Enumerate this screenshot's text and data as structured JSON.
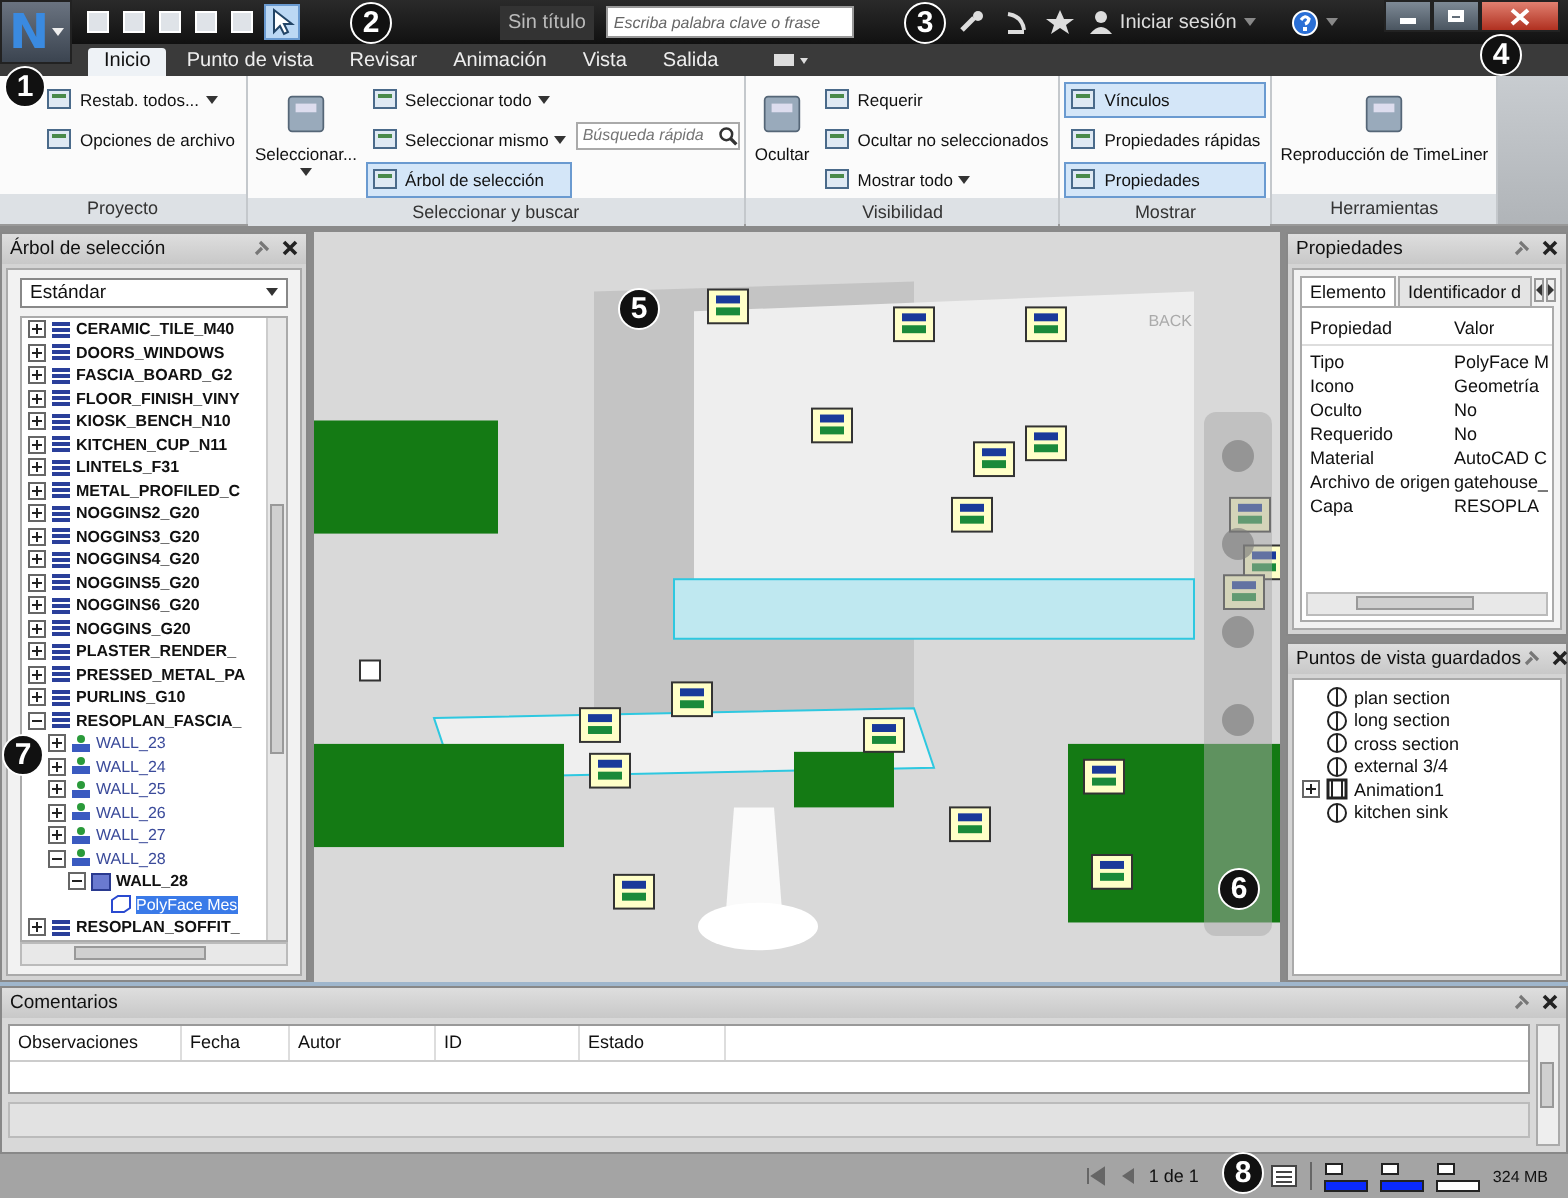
{
  "app_button": {
    "letter": "N"
  },
  "title": "Sin título",
  "search": {
    "placeholder": "Escriba palabra clave o frase"
  },
  "sign_in": "Iniciar sesión",
  "tabs": [
    {
      "label": "Inicio",
      "selected": true
    },
    {
      "label": "Punto de vista",
      "selected": false
    },
    {
      "label": "Revisar",
      "selected": false
    },
    {
      "label": "Animación",
      "selected": false
    },
    {
      "label": "Vista",
      "selected": false
    },
    {
      "label": "Salida",
      "selected": false
    }
  ],
  "ribbon": {
    "panels": [
      {
        "title": "Proyecto",
        "columns": [
          [
            {
              "kind": "small",
              "label": "Restab. todos...",
              "dropdown": true,
              "selected": false
            },
            {
              "kind": "small",
              "label": "Opciones de archivo",
              "dropdown": false,
              "selected": false
            }
          ]
        ]
      },
      {
        "title": "Seleccionar y buscar",
        "columns": [
          [
            {
              "kind": "large",
              "label": "Seleccionar...",
              "dropdown": true,
              "selected": false
            }
          ],
          [
            {
              "kind": "small",
              "label": "Seleccionar todo",
              "dropdown": true,
              "selected": false
            },
            {
              "kind": "small",
              "label": "Seleccionar mismo",
              "dropdown": true,
              "selected": false
            },
            {
              "kind": "small",
              "label": "Árbol de selección",
              "dropdown": false,
              "selected": true
            }
          ],
          [
            {
              "kind": "search",
              "placeholder": "Búsqueda rápida"
            }
          ]
        ]
      },
      {
        "title": "Visibilidad",
        "columns": [
          [
            {
              "kind": "large",
              "label": "Ocultar",
              "dropdown": false,
              "selected": false
            }
          ],
          [
            {
              "kind": "small",
              "label": "Requerir",
              "dropdown": false,
              "selected": false
            },
            {
              "kind": "small",
              "label": "Ocultar no seleccionados",
              "dropdown": false,
              "selected": false
            },
            {
              "kind": "small",
              "label": "Mostrar todo",
              "dropdown": true,
              "selected": false
            }
          ]
        ]
      },
      {
        "title": "Mostrar",
        "columns": [
          [
            {
              "kind": "small",
              "label": "Vínculos",
              "dropdown": false,
              "selected": true
            },
            {
              "kind": "small",
              "label": "Propiedades rápidas",
              "dropdown": false,
              "selected": false
            },
            {
              "kind": "small",
              "label": "Propiedades",
              "dropdown": false,
              "selected": true
            }
          ]
        ]
      },
      {
        "title": "Herramientas",
        "columns": [
          [
            {
              "kind": "large",
              "label": "Reproducción de TimeLiner",
              "dropdown": false,
              "selected": false
            }
          ]
        ]
      }
    ]
  },
  "selection_tree": {
    "title": "Árbol de selección",
    "mode": "Estándar",
    "items": [
      {
        "label": "CERAMIC_TILE_M40",
        "kind": "layer",
        "expanded": false,
        "selected": false
      },
      {
        "label": "DOORS_WINDOWS",
        "kind": "layer",
        "expanded": false,
        "selected": false
      },
      {
        "label": "FASCIA_BOARD_G2",
        "kind": "layer",
        "expanded": false,
        "selected": false
      },
      {
        "label": "FLOOR_FINISH_VINY",
        "kind": "layer",
        "expanded": false,
        "selected": false
      },
      {
        "label": "KIOSK_BENCH_N10",
        "kind": "layer",
        "expanded": false,
        "selected": false
      },
      {
        "label": "KITCHEN_CUP_N11",
        "kind": "layer",
        "expanded": false,
        "selected": false
      },
      {
        "label": "LINTELS_F31",
        "kind": "layer",
        "expanded": false,
        "selected": false
      },
      {
        "label": "METAL_PROFILED_C",
        "kind": "layer",
        "expanded": false,
        "selected": false
      },
      {
        "label": "NOGGINS2_G20",
        "kind": "layer",
        "expanded": false,
        "selected": false
      },
      {
        "label": "NOGGINS3_G20",
        "kind": "layer",
        "expanded": false,
        "selected": false
      },
      {
        "label": "NOGGINS4_G20",
        "kind": "layer",
        "expanded": false,
        "selected": false
      },
      {
        "label": "NOGGINS5_G20",
        "kind": "layer",
        "expanded": false,
        "selected": false
      },
      {
        "label": "NOGGINS6_G20",
        "kind": "layer",
        "expanded": false,
        "selected": false
      },
      {
        "label": "NOGGINS_G20",
        "kind": "layer",
        "expanded": false,
        "selected": false
      },
      {
        "label": "PLASTER_RENDER_",
        "kind": "layer",
        "expanded": false,
        "selected": false
      },
      {
        "label": "PRESSED_METAL_PA",
        "kind": "layer",
        "expanded": false,
        "selected": false
      },
      {
        "label": "PURLINS_G10",
        "kind": "layer",
        "expanded": false,
        "selected": false
      },
      {
        "label": "RESOPLAN_FASCIA_",
        "kind": "layer",
        "expanded": true,
        "selected": false,
        "children": [
          {
            "label": "WALL_23",
            "kind": "group",
            "expanded": false,
            "selected": false
          },
          {
            "label": "WALL_24",
            "kind": "group",
            "expanded": false,
            "selected": false
          },
          {
            "label": "WALL_25",
            "kind": "group",
            "expanded": false,
            "selected": false
          },
          {
            "label": "WALL_26",
            "kind": "group",
            "expanded": false,
            "selected": false
          },
          {
            "label": "WALL_27",
            "kind": "group",
            "expanded": false,
            "selected": false
          },
          {
            "label": "WALL_28",
            "kind": "group",
            "expanded": true,
            "selected": false,
            "children": [
              {
                "label": "WALL_28",
                "kind": "composite",
                "expanded": true,
                "selected": false,
                "children": [
                  {
                    "label": "PolyFace Mes",
                    "kind": "geometry",
                    "selected": true
                  }
                ]
              }
            ]
          }
        ]
      },
      {
        "label": "RESOPLAN_SOFFIT_",
        "kind": "layer",
        "expanded": false,
        "selected": false
      }
    ]
  },
  "viewcube": {
    "label": "BACK"
  },
  "properties": {
    "title": "Propiedades",
    "tabs": [
      {
        "label": "Elemento",
        "selected": true
      },
      {
        "label": "Identificador d",
        "selected": false
      }
    ],
    "columns": [
      "Propiedad",
      "Valor"
    ],
    "rows": [
      [
        "Tipo",
        "PolyFace M"
      ],
      [
        "Icono",
        "Geometría"
      ],
      [
        "Oculto",
        "No"
      ],
      [
        "Requerido",
        "No"
      ],
      [
        "Material",
        "AutoCAD C"
      ],
      [
        "Archivo de origen",
        "gatehouse_"
      ],
      [
        "Capa",
        "RESOPLA"
      ]
    ]
  },
  "saved_viewpoints": {
    "title": "Puntos de vista guardados",
    "items": [
      {
        "label": "plan section",
        "kind": "viewpoint"
      },
      {
        "label": "long section",
        "kind": "viewpoint"
      },
      {
        "label": "cross section",
        "kind": "viewpoint"
      },
      {
        "label": "external 3/4",
        "kind": "viewpoint"
      },
      {
        "label": "Animation1",
        "kind": "animation",
        "expanded": false
      },
      {
        "label": "kitchen sink",
        "kind": "viewpoint"
      }
    ]
  },
  "comments": {
    "title": "Comentarios",
    "columns": [
      "Observaciones",
      "Fecha",
      "Autor",
      "ID",
      "Estado"
    ]
  },
  "status_bar": {
    "page": "1 de 1",
    "meters": [
      {
        "level": 1
      },
      {
        "level": 1
      },
      {
        "level": 0
      }
    ],
    "memory": "324 MB"
  },
  "callouts": [
    "1",
    "2",
    "3",
    "4",
    "5",
    "6",
    "7",
    "8"
  ]
}
